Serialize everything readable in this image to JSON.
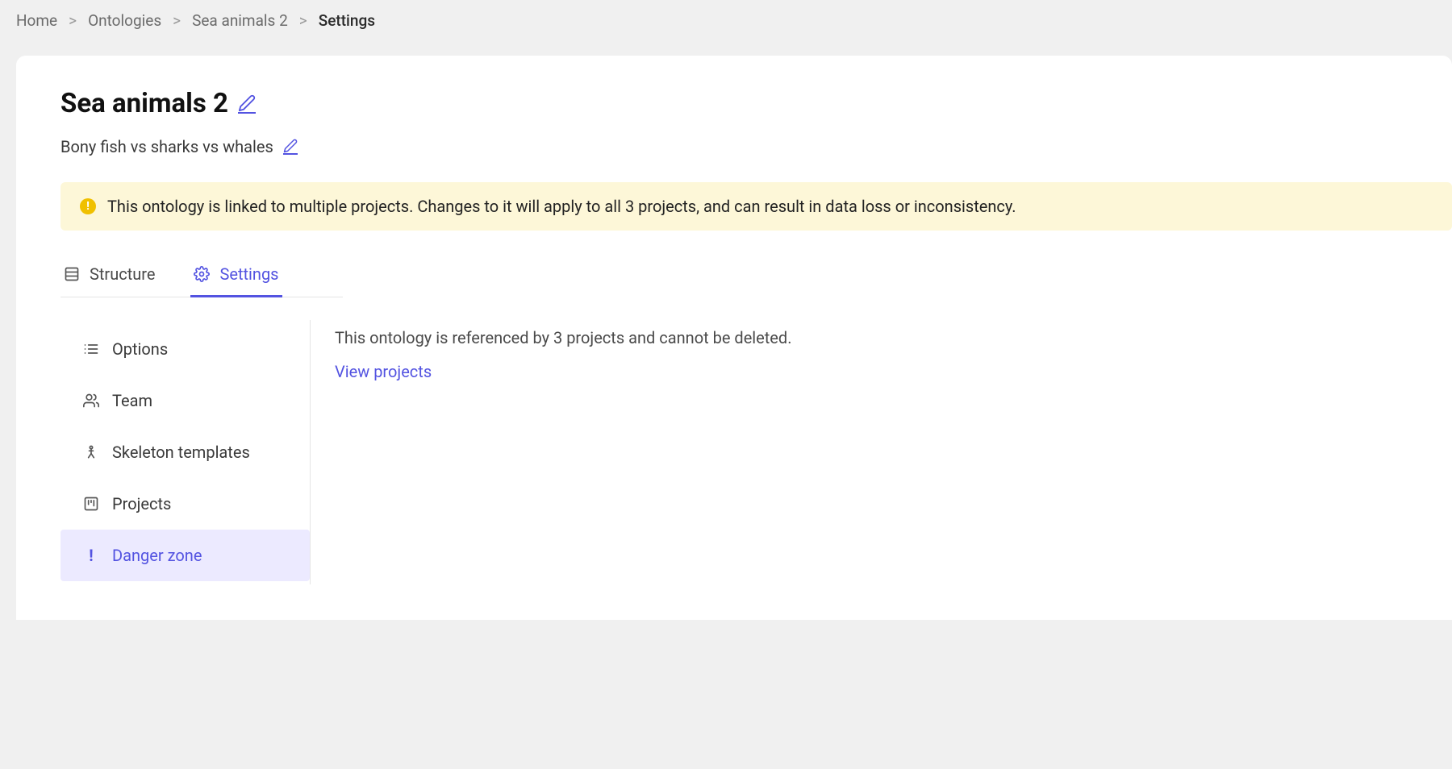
{
  "breadcrumb": {
    "items": [
      "Home",
      "Ontologies",
      "Sea animals 2"
    ],
    "current": "Settings"
  },
  "header": {
    "title": "Sea animals 2",
    "subtitle": "Bony fish vs sharks vs whales"
  },
  "alert": {
    "message": "This ontology is linked to multiple projects. Changes to it will apply to all 3 projects, and can result in data loss or inconsistency."
  },
  "tabs": {
    "structure": "Structure",
    "settings": "Settings"
  },
  "sidebar": {
    "options": "Options",
    "team": "Team",
    "skeleton": "Skeleton templates",
    "projects": "Projects",
    "danger": "Danger zone"
  },
  "content": {
    "referenced_text": "This ontology is referenced by 3 projects and cannot be deleted.",
    "view_projects": "View projects"
  },
  "colors": {
    "accent": "#5353e1",
    "warning_bg": "#fdf7d8",
    "warning_icon": "#f0c000"
  }
}
